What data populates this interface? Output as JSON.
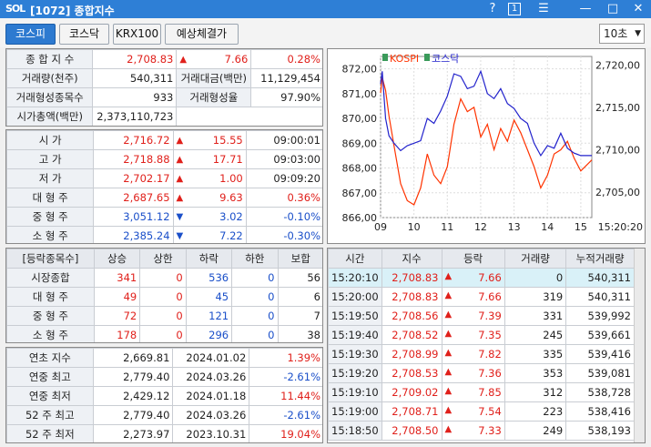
{
  "window": {
    "logo": "SOL",
    "title": "[1072] 종합지수",
    "help": "?",
    "page_num": "1",
    "menu_icon": "menu-icon",
    "minimize": "—",
    "maximize": "□",
    "close": "✕"
  },
  "toolbar": {
    "tabs": [
      "코스피",
      "코스닥",
      "KRX100",
      "예상체결가"
    ],
    "interval": "10초"
  },
  "summary": {
    "index_label": "종 합 지 수",
    "index_value": "2,708.83",
    "index_change": "7.66",
    "index_rate": "0.28%",
    "volume_label": "거래량(천주)",
    "volume_value": "540,311",
    "amount_label": "거래대금(백만)",
    "amount_value": "11,129,454",
    "formed_count_label": "거래형성종목수",
    "formed_count_value": "933",
    "formed_rate_label": "거래형성율",
    "formed_rate_value": "97.90%",
    "mcap_label": "시가총액(백만)",
    "mcap_value": "2,373,110,723"
  },
  "prices": [
    {
      "label": "시      가",
      "value": "2,716.72",
      "dir": "▲",
      "change": "15.55",
      "extra": "09:00:01",
      "color": "red"
    },
    {
      "label": "고      가",
      "value": "2,718.88",
      "dir": "▲",
      "change": "17.71",
      "extra": "09:03:00",
      "color": "red"
    },
    {
      "label": "저      가",
      "value": "2,702.17",
      "dir": "▲",
      "change": "1.00",
      "extra": "09:09:20",
      "color": "red"
    },
    {
      "label": "대 형 주",
      "value": "2,687.65",
      "dir": "▲",
      "change": "9.63",
      "extra": "0.36%",
      "color": "red"
    },
    {
      "label": "중 형 주",
      "value": "3,051.12",
      "dir": "▼",
      "change": "3.02",
      "extra": "-0.10%",
      "color": "blue"
    },
    {
      "label": "소 형 주",
      "value": "2,385.24",
      "dir": "▼",
      "change": "7.22",
      "extra": "-0.30%",
      "color": "blue"
    }
  ],
  "breadth": {
    "headers": [
      "[등락종목수]",
      "상승",
      "상한",
      "하락",
      "하한",
      "보합"
    ],
    "rows": [
      [
        "시장종합",
        "341",
        "0",
        "536",
        "0",
        "56"
      ],
      [
        "대 형 주",
        "49",
        "0",
        "45",
        "0",
        "6"
      ],
      [
        "중 형 주",
        "72",
        "0",
        "121",
        "0",
        "7"
      ],
      [
        "소 형 주",
        "178",
        "0",
        "296",
        "0",
        "38"
      ]
    ]
  },
  "yearly": [
    {
      "label": "연초  지수",
      "value": "2,669.81",
      "date": "2024.01.02",
      "rate": "1.39%",
      "color": "red"
    },
    {
      "label": "연중  최고",
      "value": "2,779.40",
      "date": "2024.03.26",
      "rate": "-2.61%",
      "color": "blue"
    },
    {
      "label": "연중  최저",
      "value": "2,429.12",
      "date": "2024.01.18",
      "rate": "11.44%",
      "color": "red"
    },
    {
      "label": "52 주 최고",
      "value": "2,779.40",
      "date": "2024.03.26",
      "rate": "-2.61%",
      "color": "blue"
    },
    {
      "label": "52 주 최저",
      "value": "2,273.97",
      "date": "2023.10.31",
      "rate": "19.04%",
      "color": "red"
    }
  ],
  "ticks": {
    "headers": [
      "시간",
      "지수",
      "등락",
      "거래량",
      "누적거래량"
    ],
    "rows": [
      [
        "15:20:10",
        "2,708.83",
        "7.66",
        "0",
        "540,311"
      ],
      [
        "15:20:00",
        "2,708.83",
        "7.66",
        "319",
        "540,311"
      ],
      [
        "15:19:50",
        "2,708.56",
        "7.39",
        "331",
        "539,992"
      ],
      [
        "15:19:40",
        "2,708.52",
        "7.35",
        "245",
        "539,661"
      ],
      [
        "15:19:30",
        "2,708.99",
        "7.82",
        "335",
        "539,416"
      ],
      [
        "15:19:20",
        "2,708.53",
        "7.36",
        "353",
        "539,081"
      ],
      [
        "15:19:10",
        "2,709.02",
        "7.85",
        "312",
        "538,728"
      ],
      [
        "15:19:00",
        "2,708.71",
        "7.54",
        "223",
        "538,416"
      ],
      [
        "15:18:50",
        "2,708.50",
        "7.33",
        "249",
        "538,193"
      ]
    ]
  },
  "colors": {
    "kospi": "#ff3300",
    "kosdaq": "#2222cc",
    "red": "#e0201b",
    "blue": "#1a4fc9"
  },
  "chart_data": {
    "type": "line",
    "legend": [
      "KOSPI",
      "코스닥"
    ],
    "x_ticks": [
      "09",
      "10",
      "11",
      "12",
      "13",
      "14",
      "15"
    ],
    "x_end_label": "15:20:20",
    "y_left_ticks": [
      "872,00",
      "871,00",
      "870,00",
      "869,00",
      "868,00",
      "867,00",
      "866,00"
    ],
    "y_right_ticks": [
      "2,720,00",
      "2,715,00",
      "2,710,00",
      "2,705,00"
    ],
    "ylim_left": [
      866,
      872.5
    ],
    "ylim_right": [
      2702,
      2721
    ],
    "series": [
      {
        "name": "KOSPI",
        "axis": "right",
        "x": [
          9.0,
          9.05,
          9.15,
          9.25,
          9.4,
          9.6,
          9.8,
          10.0,
          10.2,
          10.4,
          10.6,
          10.8,
          11.0,
          11.2,
          11.4,
          11.6,
          11.8,
          12.0,
          12.2,
          12.4,
          12.6,
          12.8,
          13.0,
          13.2,
          13.4,
          13.6,
          13.8,
          14.0,
          14.2,
          14.4,
          14.6,
          14.8,
          15.0,
          15.33
        ],
        "values": [
          2716.7,
          2718.5,
          2717.0,
          2714.0,
          2710.5,
          2706.0,
          2704.0,
          2703.5,
          2705.5,
          2709.5,
          2707.0,
          2706.0,
          2708.0,
          2713.0,
          2716.0,
          2714.5,
          2715.0,
          2711.5,
          2713.0,
          2710.0,
          2712.5,
          2711.0,
          2713.5,
          2712.0,
          2710.0,
          2708.0,
          2705.5,
          2707.0,
          2709.5,
          2710.0,
          2711.0,
          2709.0,
          2707.5,
          2708.8
        ]
      },
      {
        "name": "코스닥",
        "axis": "left",
        "x": [
          9.0,
          9.05,
          9.15,
          9.25,
          9.4,
          9.6,
          9.8,
          10.0,
          10.2,
          10.4,
          10.6,
          10.8,
          11.0,
          11.2,
          11.4,
          11.6,
          11.8,
          12.0,
          12.2,
          12.4,
          12.6,
          12.8,
          13.0,
          13.2,
          13.4,
          13.6,
          13.8,
          14.0,
          14.2,
          14.4,
          14.6,
          14.8,
          15.0,
          15.33
        ],
        "values": [
          871.4,
          871.9,
          870.0,
          869.3,
          869.0,
          868.7,
          868.9,
          869.0,
          869.1,
          870.0,
          869.8,
          870.3,
          870.9,
          871.8,
          871.7,
          871.2,
          871.3,
          871.9,
          871.0,
          870.8,
          871.2,
          870.6,
          870.4,
          870.0,
          869.8,
          869.0,
          868.5,
          868.9,
          868.8,
          869.4,
          868.8,
          868.6,
          868.5,
          868.5
        ]
      }
    ]
  }
}
